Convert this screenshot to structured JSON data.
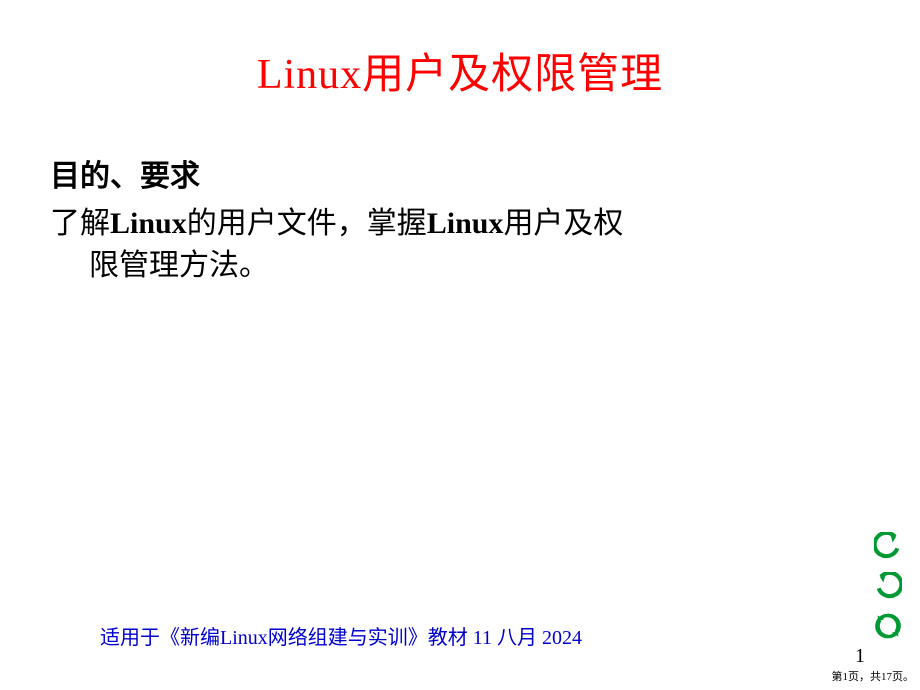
{
  "title": "Linux用户及权限管理",
  "subtitle": "目的、要求",
  "body": {
    "line1_prefix": "了解",
    "line1_bold1": "Linux",
    "line1_mid": "的用户文件，掌握",
    "line1_bold2": "Linux",
    "line1_suffix": "用户及权",
    "line2": "限管理方法。"
  },
  "footer": {
    "prefix": "适用于《新编",
    "bold": "Linux",
    "suffix": "网络组建与实训》教材  11 八月 2024"
  },
  "page_number": "1",
  "page_info": "第1页，共17页。",
  "nav": {
    "undo": "undo",
    "redo": "redo",
    "refresh": "refresh"
  }
}
